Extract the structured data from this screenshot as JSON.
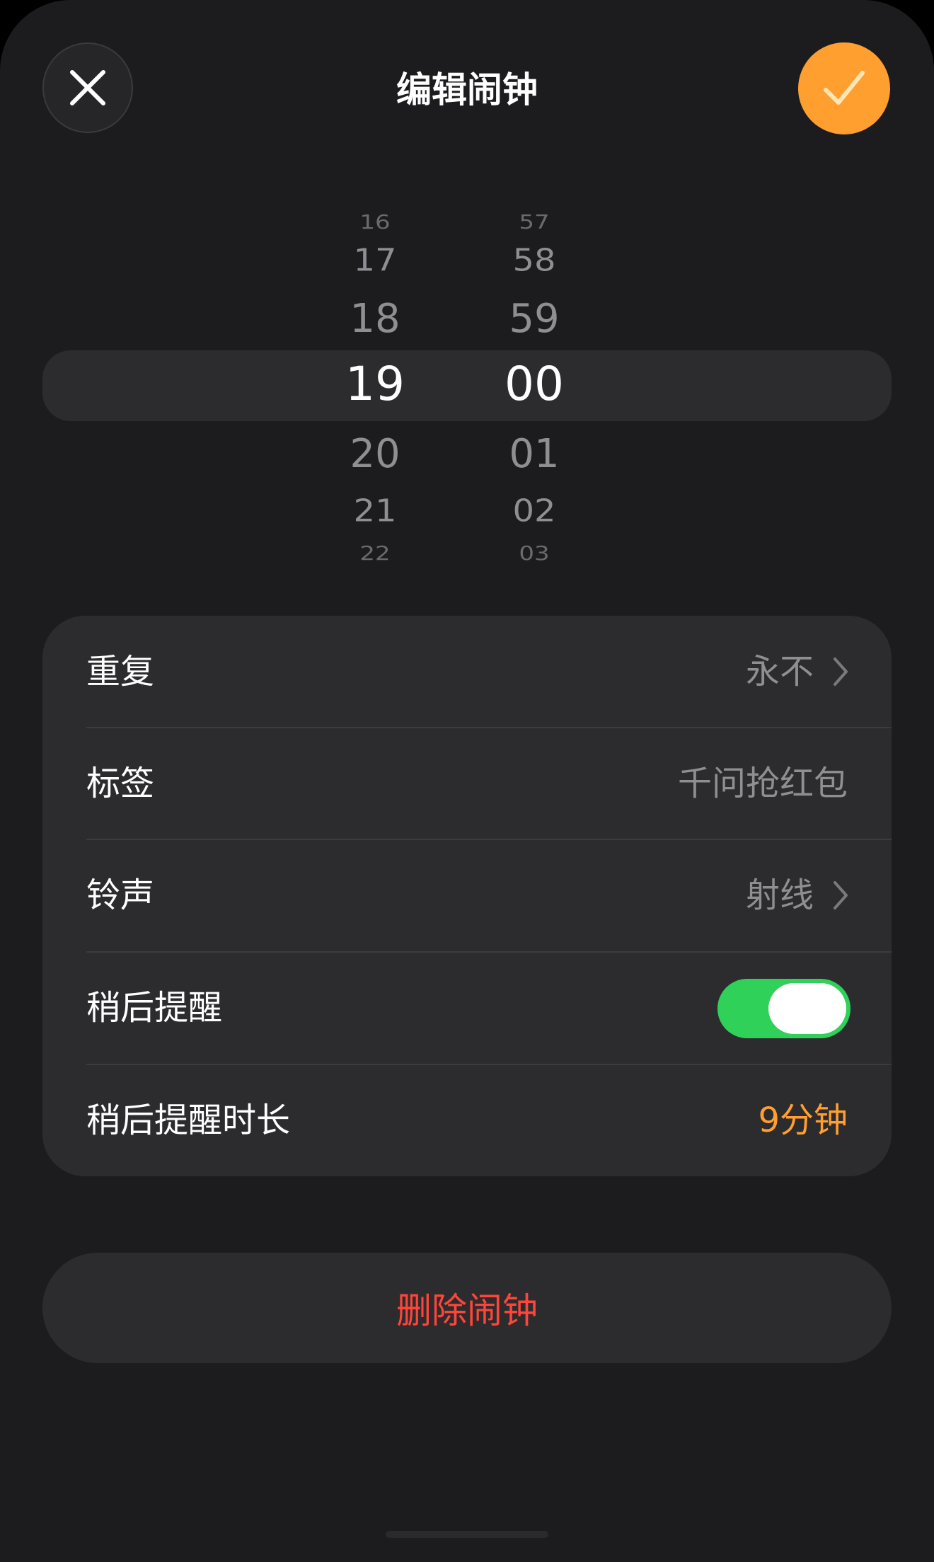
{
  "header": {
    "title": "编辑闹钟",
    "close_icon": "close-icon",
    "confirm_icon": "checkmark-icon",
    "accent_color": "#ff9f30"
  },
  "picker": {
    "hours": [
      "16",
      "17",
      "18",
      "19",
      "20",
      "21",
      "22"
    ],
    "minutes": [
      "57",
      "58",
      "59",
      "00",
      "01",
      "02",
      "03"
    ],
    "selected_hour": "19",
    "selected_minute": "00"
  },
  "settings": {
    "repeat": {
      "label": "重复",
      "value": "永不",
      "icon": "chevron-right-icon"
    },
    "label": {
      "label": "标签",
      "value": "千问抢红包"
    },
    "sound": {
      "label": "铃声",
      "value": "射线",
      "icon": "chevron-right-icon"
    },
    "snooze": {
      "label": "稍后提醒",
      "enabled": true,
      "toggle_color": "#30d158"
    },
    "snooze_duration": {
      "label": "稍后提醒时长",
      "value": "9分钟"
    }
  },
  "delete_button": {
    "label": "删除闹钟",
    "color": "#ff453a"
  }
}
